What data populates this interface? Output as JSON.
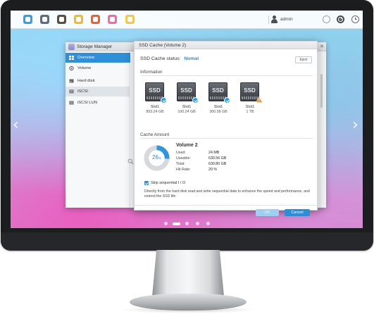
{
  "colors": {
    "accent": "#2f8fd8",
    "status_value": "#1f8fd6",
    "ssd_badge": "#25a2e3",
    "warning": "#f08a1c",
    "cancel_button": "#2b8ed6",
    "ok_button_disabled": "#9fcfef"
  },
  "taskbar": {
    "apps": [
      {
        "icon": "file-station-icon",
        "color": "#3a9ee4"
      },
      {
        "icon": "control-panel-icon",
        "color": "#5a6d84"
      },
      {
        "icon": "qts-app-icon",
        "color": "#5c4f3f"
      },
      {
        "icon": "folder-icon",
        "color": "#f5b833"
      },
      {
        "icon": "app-center-icon",
        "color": "#e8623a"
      },
      {
        "icon": "storage-manager-icon",
        "color": "#ec6f9e"
      },
      {
        "icon": "note-station-icon",
        "color": "#f2c94c"
      }
    ],
    "username": "admin"
  },
  "storage_manager": {
    "title": "Storage Manager",
    "sidebar": [
      {
        "label": "Overview",
        "icon": "overview-icon",
        "state": "active"
      },
      {
        "label": "Volume",
        "icon": "volume-icon",
        "state": "normal"
      },
      {
        "label": "Hard disk",
        "icon": "hard-disk-icon",
        "state": "normal"
      },
      {
        "label": "iSCSI",
        "icon": "iscsi-icon",
        "state": "hover"
      },
      {
        "label": "iSCSI LUN",
        "icon": "iscsi-lun-icon",
        "state": "normal"
      }
    ]
  },
  "dialog": {
    "title": "SSD Cache (Volume 2)",
    "status_label": "SSD Cache status:",
    "status_value": "Nomal",
    "eject_label": "Eject",
    "information_label": "Information",
    "ssds": [
      {
        "text": "SSD",
        "slot": "Slot1",
        "size": "893.24 GB",
        "badge": "check"
      },
      {
        "text": "SSD",
        "slot": "Slot1",
        "size": "100.24 GB",
        "badge": "check"
      },
      {
        "text": "SSD",
        "slot": "Slot1",
        "size": "300.58 GB",
        "badge": "check"
      },
      {
        "text": "SSD",
        "slot": "Slot1",
        "size": "1 TB",
        "badge": "warning"
      }
    ],
    "cache_amount_label": "Cache Amount",
    "donut": {
      "percent": 26,
      "value_text": "26",
      "unit": "%"
    },
    "volume_name": "Volume 2",
    "stats": [
      {
        "key": "Used:",
        "value": "24 MB"
      },
      {
        "key": "Useable:",
        "value": "630.56 GB"
      },
      {
        "key": "Total:",
        "value": "630.80 GB"
      },
      {
        "key": "Hit Rate:",
        "value": "20 %"
      }
    ],
    "skip_label": "Skip sequential I / O",
    "skip_checked": true,
    "description": "Directly from the hard disk read and write sequential data to enhance the speed and performance, and extend the SSD life",
    "ok_label": "OK",
    "cancel_label": "Cancel"
  },
  "carousel": {
    "count": 5,
    "active_index": 1
  }
}
